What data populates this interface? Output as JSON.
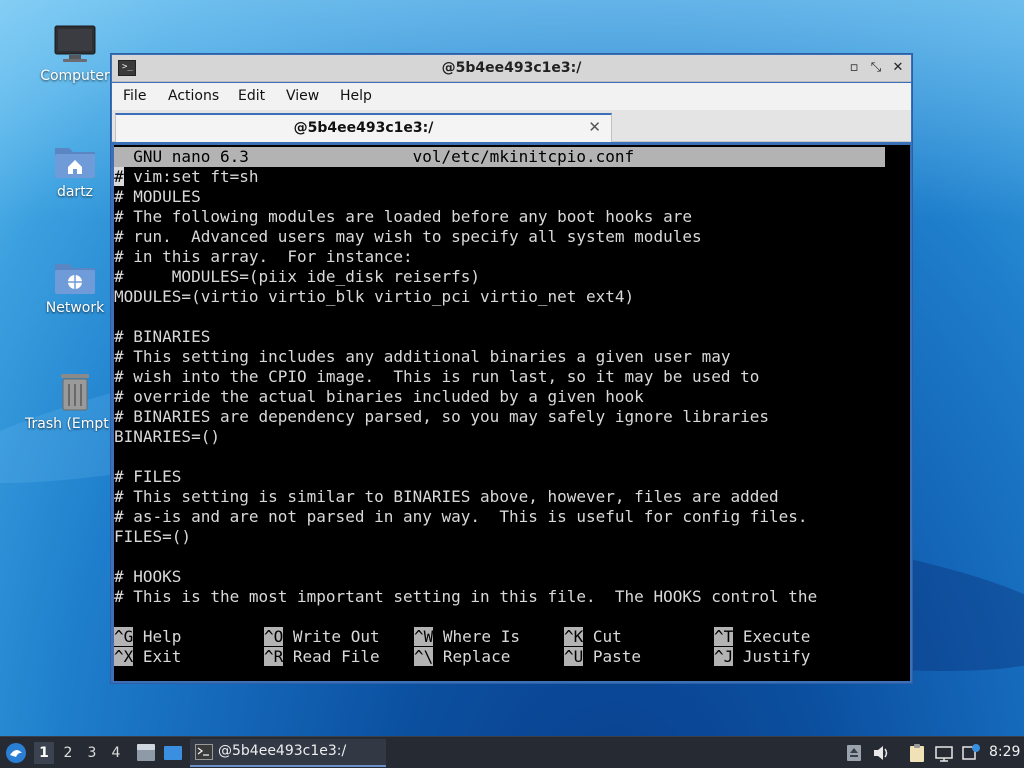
{
  "desktop": {
    "icons": [
      {
        "label": "Computer",
        "icon": "computer-icon"
      },
      {
        "label": "dartz",
        "icon": "home-folder-icon"
      },
      {
        "label": "Network",
        "icon": "network-folder-icon"
      },
      {
        "label": "Trash (Empty)",
        "icon": "trash-icon"
      }
    ]
  },
  "window": {
    "title": "@5b4ee493c1e3:/",
    "controls": {
      "minimize": "▫",
      "maximize": "⤡",
      "close": "✕"
    },
    "menu": [
      "File",
      "Actions",
      "Edit",
      "View",
      "Help"
    ],
    "tab": {
      "title": "@5b4ee493c1e3:/",
      "close": "✕"
    }
  },
  "nano": {
    "header": "  GNU nano 6.3                 vol/etc/mkinitcpio.conf",
    "cursor_char": "#",
    "lines": [
      " vim:set ft=sh",
      "# MODULES",
      "# The following modules are loaded before any boot hooks are",
      "# run.  Advanced users may wish to specify all system modules",
      "# in this array.  For instance:",
      "#     MODULES=(piix ide_disk reiserfs)",
      "MODULES=(virtio virtio_blk virtio_pci virtio_net ext4)",
      "",
      "# BINARIES",
      "# This setting includes any additional binaries a given user may",
      "# wish into the CPIO image.  This is run last, so it may be used to",
      "# override the actual binaries included by a given hook",
      "# BINARIES are dependency parsed, so you may safely ignore libraries",
      "BINARIES=()",
      "",
      "# FILES",
      "# This setting is similar to BINARIES above, however, files are added",
      "# as-is and are not parsed in any way.  This is useful for config files.",
      "FILES=()",
      "",
      "# HOOKS",
      "# This is the most important setting in this file.  The HOOKS control the"
    ],
    "shortcuts": [
      [
        {
          "key": "^G",
          "label": " Help"
        },
        {
          "key": "^O",
          "label": " Write Out"
        },
        {
          "key": "^W",
          "label": " Where Is"
        },
        {
          "key": "^K",
          "label": " Cut"
        },
        {
          "key": "^T",
          "label": " Execute"
        }
      ],
      [
        {
          "key": "^X",
          "label": " Exit"
        },
        {
          "key": "^R",
          "label": " Read File"
        },
        {
          "key": "^\\",
          "label": " Replace"
        },
        {
          "key": "^U",
          "label": " Paste"
        },
        {
          "key": "^J",
          "label": " Justify"
        }
      ]
    ]
  },
  "taskbar": {
    "workspaces": [
      "1",
      "2",
      "3",
      "4"
    ],
    "active_workspace": "1",
    "task_label": "@5b4ee493c1e3:/",
    "clock": "8:29"
  },
  "colors": {
    "accent": "#3b6fb8",
    "taskbar": "#262b33",
    "terminal_bg": "#000000",
    "nano_bar": "#b3b3b3"
  }
}
